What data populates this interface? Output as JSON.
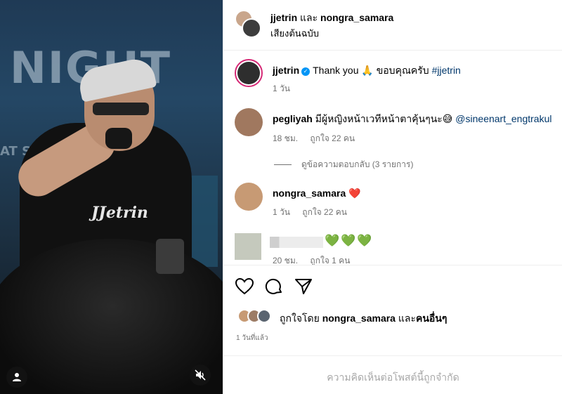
{
  "media": {
    "sign_text": "NIGHT",
    "sign_sub": "AT SO",
    "shirt_logo": "JJetrin"
  },
  "header": {
    "user1": "jjetrin",
    "conjunction": "และ",
    "user2": "nongra_samara",
    "audio": "เสียงต้นฉบับ"
  },
  "caption": {
    "username": "jjetrin",
    "text": "Thank you 🙏 ขอบคุณครับ",
    "hashtag": "#jjetrin",
    "time": "1 วัน"
  },
  "comments": [
    {
      "username": "pegliyah",
      "text": "มีผู้หญิงหน้าเวทีหน้าตาคุ้นๆนะ😅",
      "mention": "@sineenart_engtrakul",
      "time": "18 ชม.",
      "likes": "ถูกใจ 22 คน"
    },
    {
      "username": "nongra_samara",
      "text": "❤️",
      "time": "1 วัน",
      "likes": "ถูกใจ 22 คน"
    },
    {
      "username": "",
      "text": "💚💚💚",
      "time": "20 ชม.",
      "likes": "ถูกใจ 1 คน"
    }
  ],
  "replies_link": "ดูข้อความตอบกลับ (3 รายการ)",
  "liked_by": {
    "prefix": "ถูกใจโดย",
    "user": "nongra_samara",
    "conj": "และ",
    "others": "คนอื่นๆ"
  },
  "post_date": "1 วันที่แล้ว",
  "comments_limited": "ความคิดเห็นต่อโพสต์นี้ถูกจำกัด",
  "colors": {
    "link": "#00376b",
    "meta": "#737373",
    "verified": "#0095f6",
    "ring": "#d62976"
  }
}
